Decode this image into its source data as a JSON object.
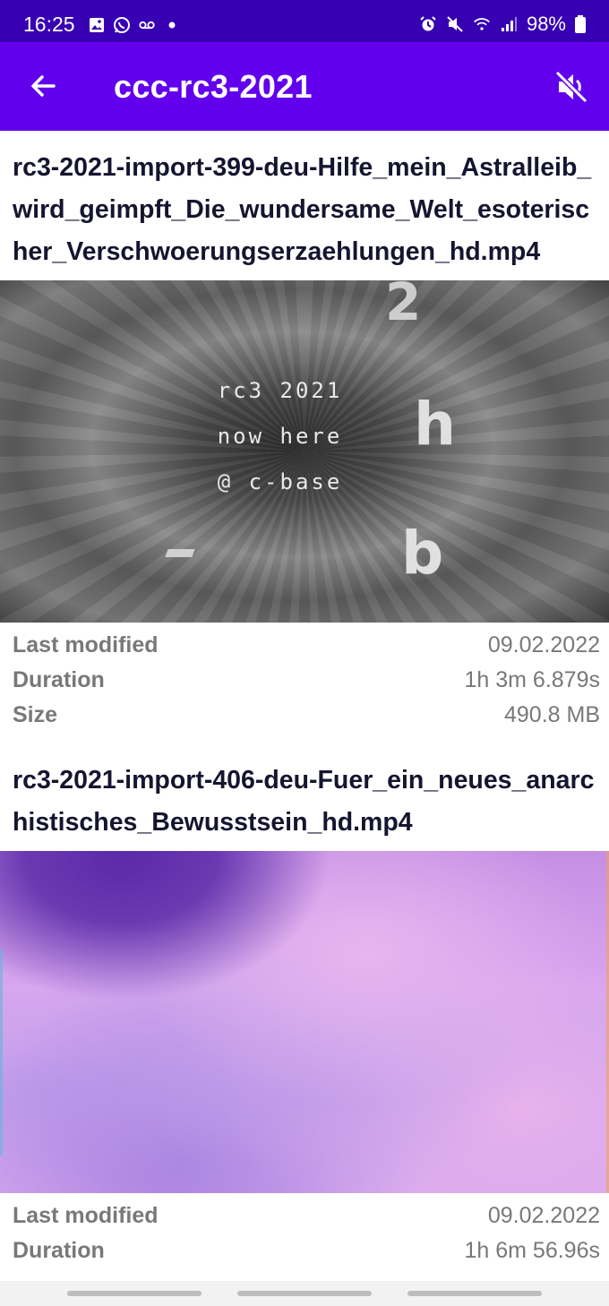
{
  "status_bar": {
    "time": "16:25",
    "battery": "98%",
    "left_icons": [
      "gallery-icon",
      "whatsapp-icon",
      "voicemail-icon",
      "dot-icon"
    ],
    "right_icons": [
      "alarm-icon",
      "mute-icon",
      "wifi-icon",
      "signal-icon",
      "battery-icon"
    ]
  },
  "app_bar": {
    "title": "ccc-rc3-2021",
    "back_icon": "arrow-back-icon",
    "action_icon": "volume-off-icon"
  },
  "videos": [
    {
      "title": "rc3-2021-import-399-deu-Hilfe_mein_Astralleib_wird_geimpft_Die_wundersame_Welt_esoterischer_Verschwoerungserzaehlungen_hd.mp4",
      "thumbnail_text": [
        "rc3 2021",
        "now here",
        "@ c-base"
      ],
      "thumbnail_glyphs": [
        "2",
        "h",
        "b"
      ],
      "last_modified_label": "Last modified",
      "last_modified": "09.02.2022",
      "duration_label": "Duration",
      "duration": "1h 3m 6.879s",
      "size_label": "Size",
      "size": "490.8 MB"
    },
    {
      "title": "rc3-2021-import-406-deu-Fuer_ein_neues_anarchistisches_Bewusstsein_hd.mp4",
      "last_modified_label": "Last modified",
      "last_modified": "09.02.2022",
      "duration_label": "Duration",
      "duration": "1h 6m 56.96s"
    }
  ],
  "colors": {
    "status_bar": "#3700b3",
    "app_bar": "#6200ee",
    "title_text": "#151530",
    "meta_text": "#787878"
  }
}
